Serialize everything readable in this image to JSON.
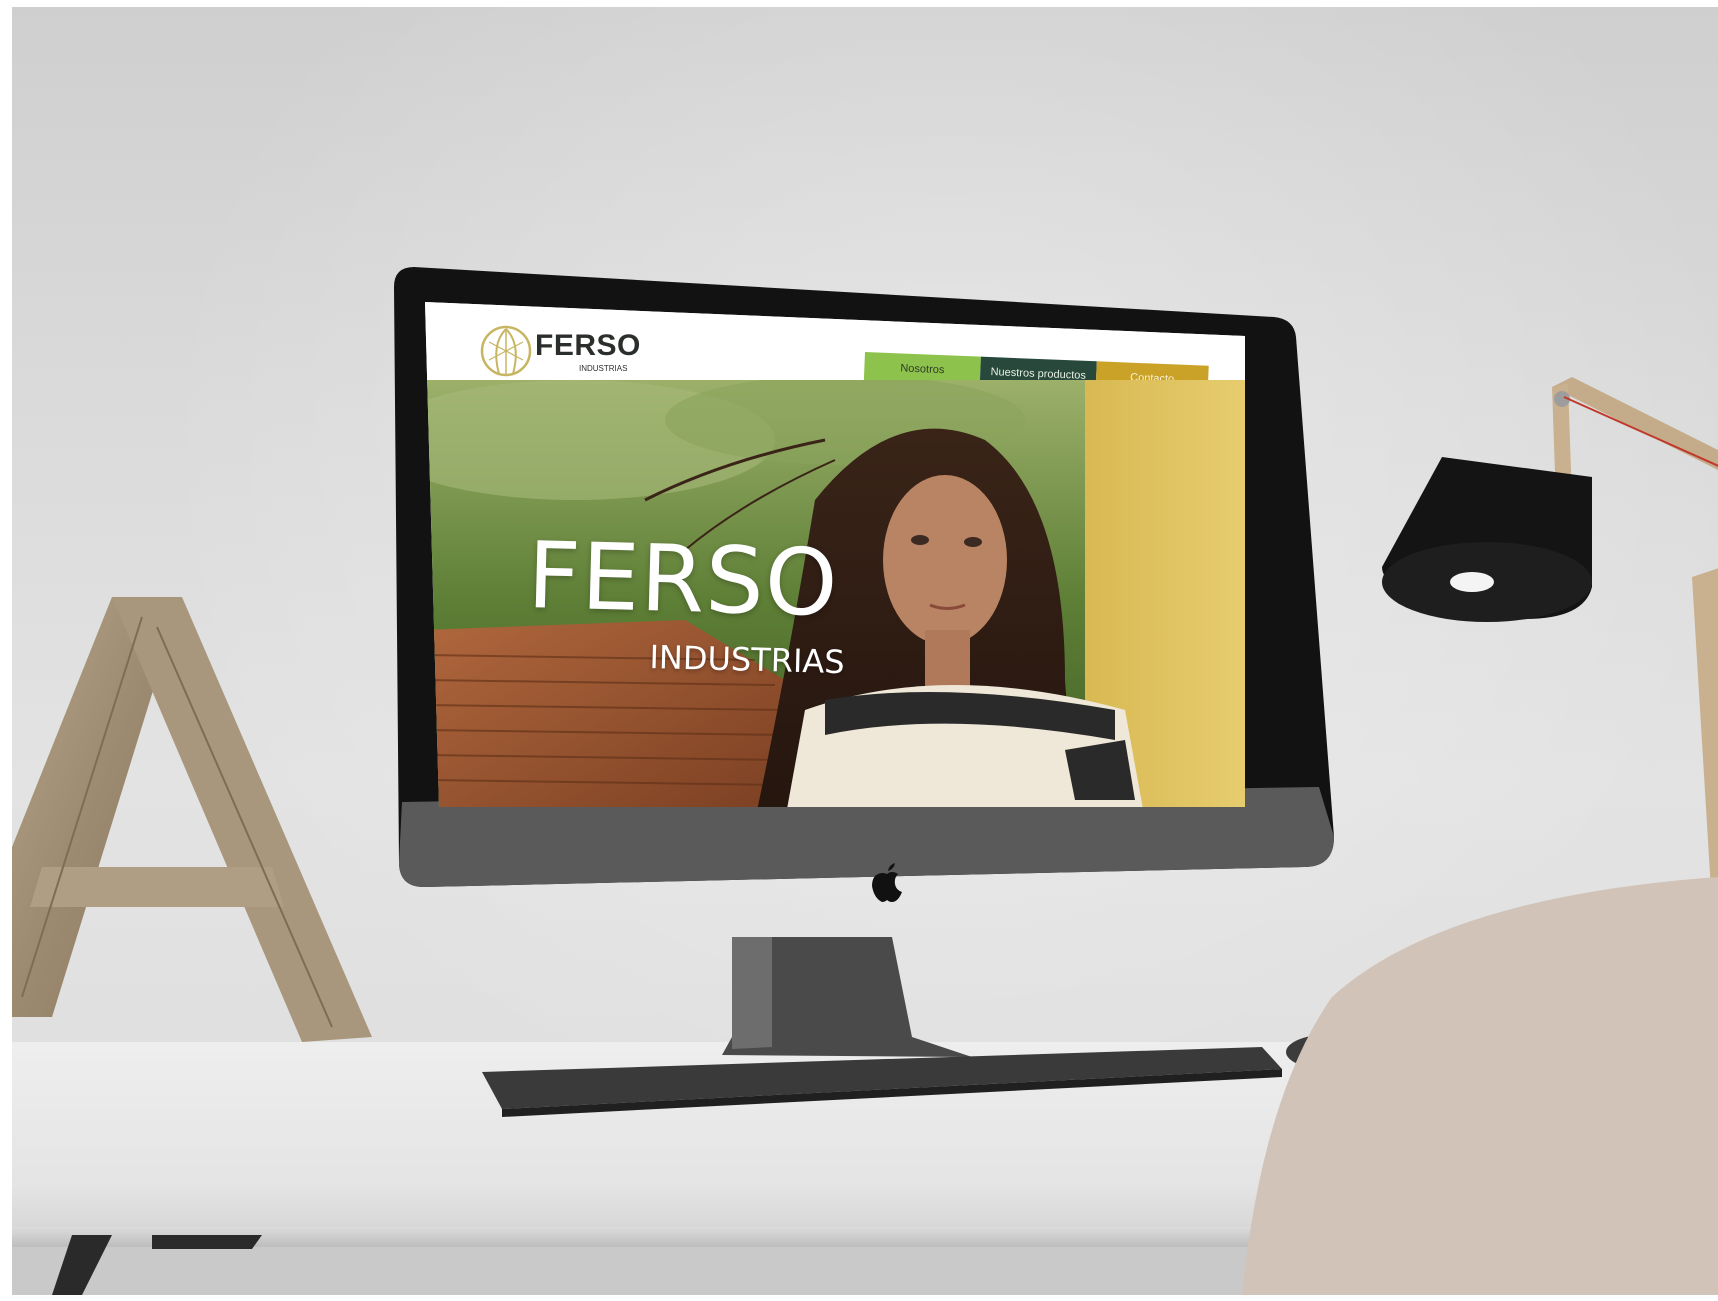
{
  "site": {
    "logo": {
      "name": "FERSO",
      "subtitle": "INDUSTRIAS"
    },
    "nav": {
      "items": [
        {
          "label": "Nosotros",
          "bg": "#8dc34c",
          "fg": "#2f3b25"
        },
        {
          "label": "Nuestros productos",
          "bg": "#27483a",
          "fg": "#e8f0e6"
        },
        {
          "label": "Contacto",
          "bg": "#c9a227",
          "fg": "#f8f1d8"
        }
      ]
    },
    "hero": {
      "title": "FERSO",
      "subtitle": "INDUSTRIAS"
    }
  },
  "colors": {
    "brand_green": "#8dc34c",
    "brand_dark_green": "#27483a",
    "brand_gold": "#c9a227",
    "logo_mark": "#c7b561"
  },
  "icons": [
    "ferso-logo-icon",
    "apple-logo-icon"
  ]
}
